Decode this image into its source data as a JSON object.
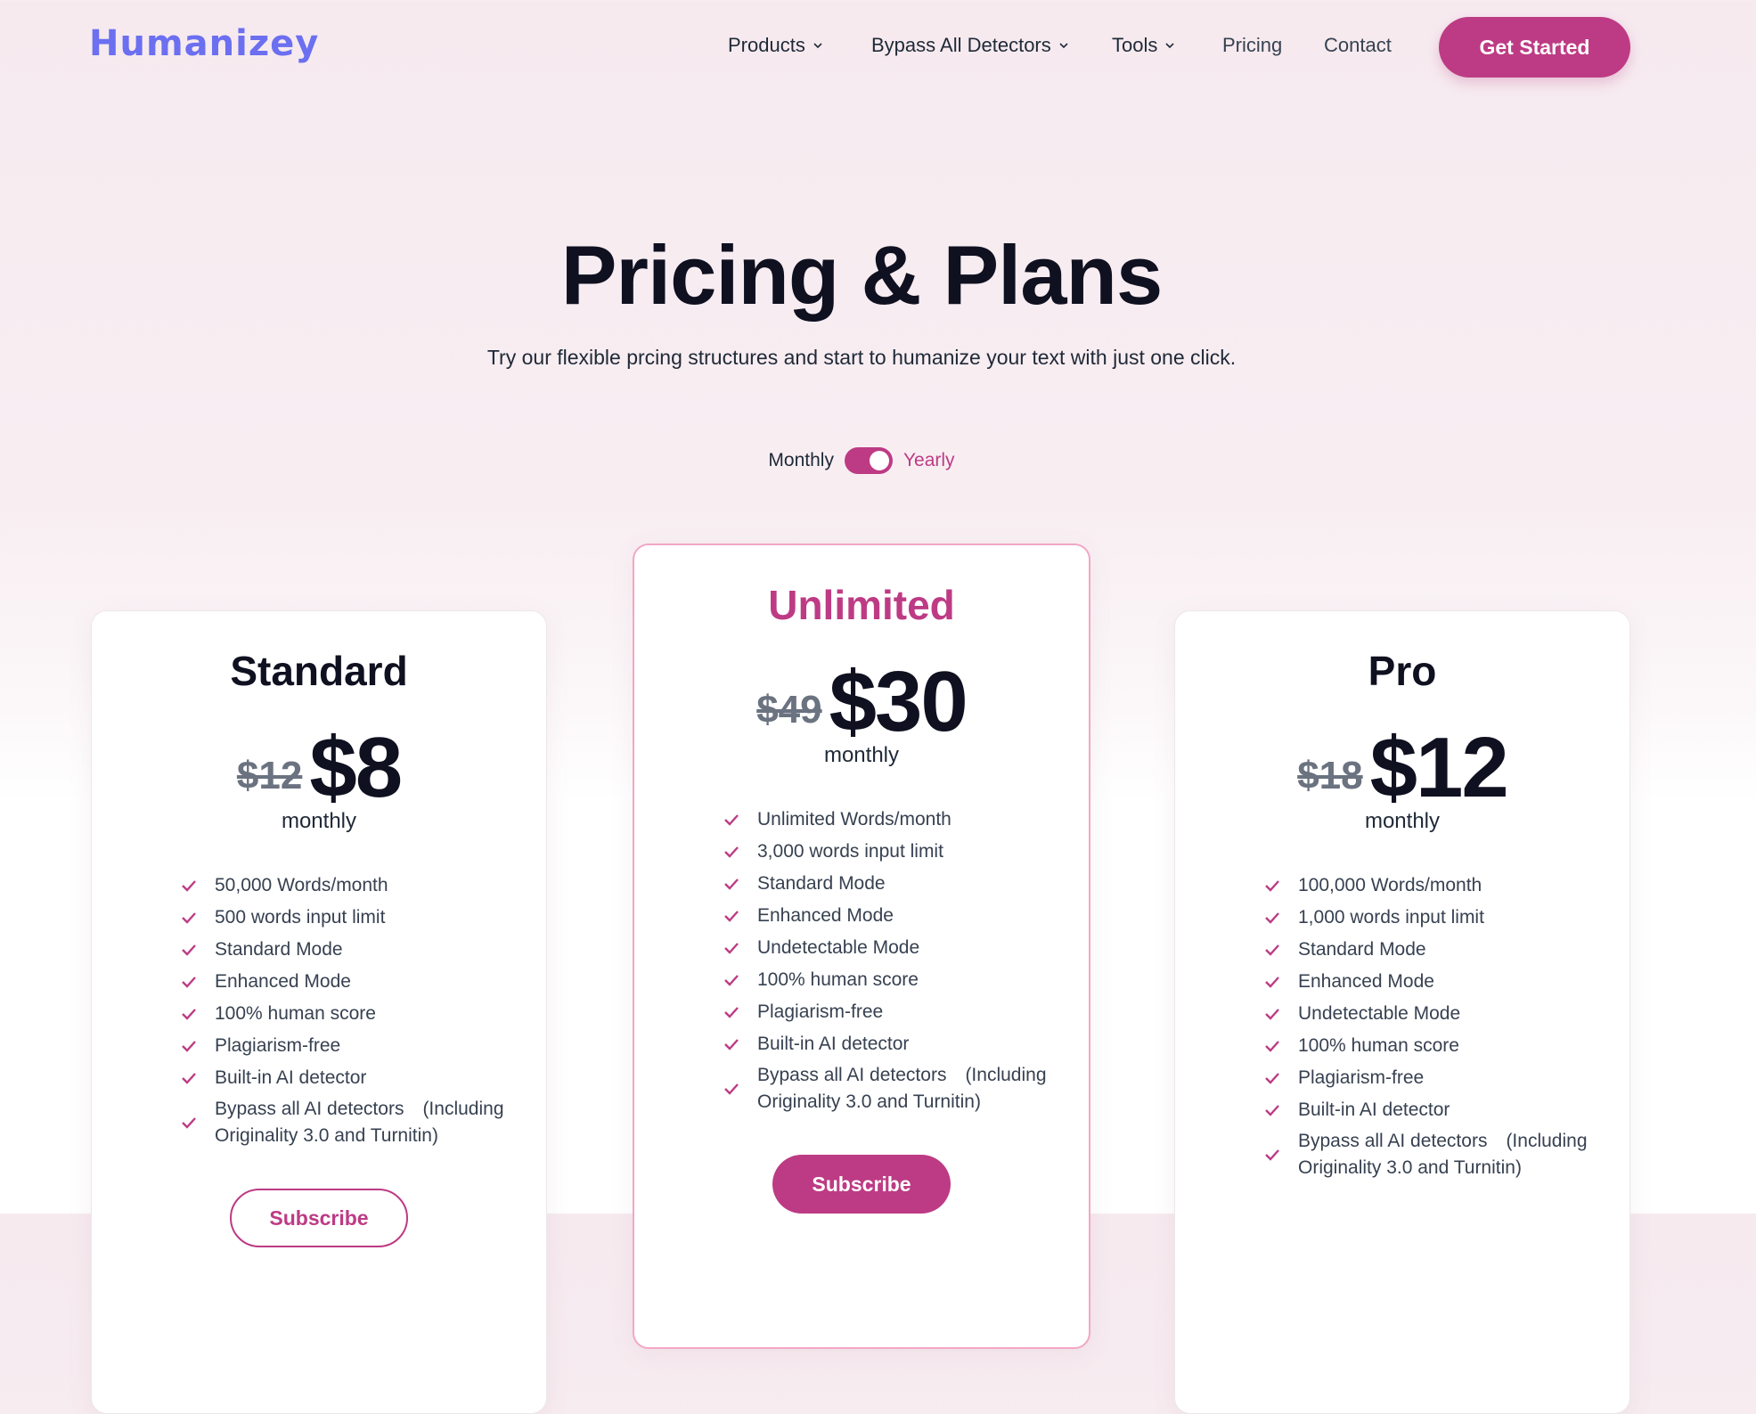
{
  "brand": {
    "logo": "Humanizey",
    "accent": "#bd3b84",
    "logo_color": "#6b6ff0"
  },
  "nav": {
    "items": [
      {
        "label": "Products",
        "dropdown": true
      },
      {
        "label": "Bypass All Detectors",
        "dropdown": true
      },
      {
        "label": "Tools",
        "dropdown": true
      },
      {
        "label": "Pricing",
        "dropdown": false
      },
      {
        "label": "Contact",
        "dropdown": false
      }
    ],
    "cta": "Get Started"
  },
  "hero": {
    "title": "Pricing & Plans",
    "subtitle": "Try our flexible prcing structures and start to humanize your text with just one click."
  },
  "billing_toggle": {
    "left_label": "Monthly",
    "right_label": "Yearly",
    "selected": "Yearly"
  },
  "plans": [
    {
      "name": "Standard",
      "old_price": "$12",
      "price": "$8",
      "period": "monthly",
      "features": [
        "50,000 Words/month",
        "500 words input limit",
        "Standard Mode",
        "Enhanced Mode",
        "100% human score",
        "Plagiarism-free",
        "Built-in AI detector",
        "Bypass all AI detectors　(Including Originality 3.0 and Turnitin)"
      ],
      "button": "Subscribe"
    },
    {
      "name": "Unlimited",
      "old_price": "$49",
      "price": "$30",
      "period": "monthly",
      "features": [
        "Unlimited Words/month",
        "3,000 words input limit",
        "Standard Mode",
        "Enhanced Mode",
        "Undetectable Mode",
        "100% human score",
        "Plagiarism-free",
        "Built-in AI detector",
        "Bypass all AI detectors　(Including Originality 3.0 and Turnitin)"
      ],
      "button": "Subscribe"
    },
    {
      "name": "Pro",
      "old_price": "$18",
      "price": "$12",
      "period": "monthly",
      "features": [
        "100,000 Words/month",
        "1,000 words input limit",
        "Standard Mode",
        "Enhanced Mode",
        "Undetectable Mode",
        "100% human score",
        "Plagiarism-free",
        "Built-in AI detector",
        "Bypass all AI detectors　(Including Originality 3.0 and Turnitin)"
      ]
    }
  ]
}
